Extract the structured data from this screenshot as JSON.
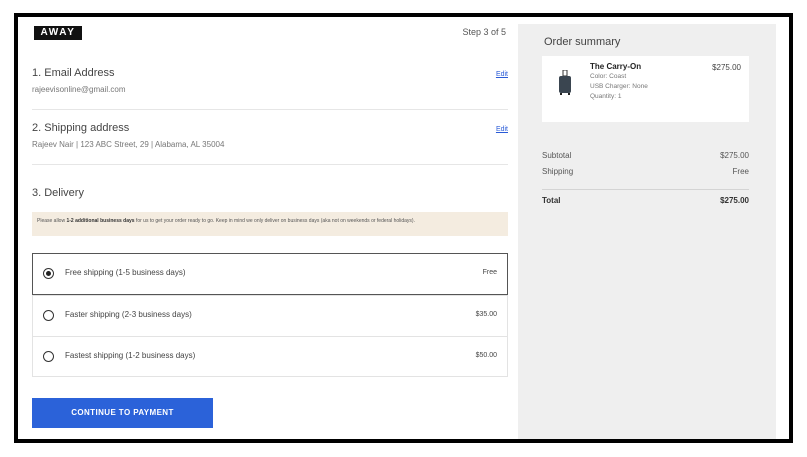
{
  "header": {
    "logo": "AWAY",
    "step": "Step 3 of 5"
  },
  "email": {
    "title": "1. Email Address",
    "value": "rajeevisonline@gmail.com",
    "edit": "Edit"
  },
  "shipping": {
    "title": "2. Shipping address",
    "value": "Rajeev Nair | 123 ABC Street, 29 | Alabama, AL 35004",
    "edit": "Edit"
  },
  "delivery": {
    "title": "3. Delivery",
    "notice_pre": "Please allow ",
    "notice_bold": "1-2 additional business days",
    "notice_post": " for us to get your order ready to go. Keep in mind we only deliver on business days (aka not on weekends or federal holidays).",
    "options": [
      {
        "label": "Free shipping (1-5 business days)",
        "price": "Free",
        "selected": true
      },
      {
        "label": "Faster shipping (2-3 business days)",
        "price": "$35.00",
        "selected": false
      },
      {
        "label": "Fastest shipping (1-2 business days)",
        "price": "$50.00",
        "selected": false
      }
    ]
  },
  "continue_label": "CONTINUE TO PAYMENT",
  "summary": {
    "title": "Order summary",
    "product": {
      "name": "The Carry-On",
      "color": "Color: Coast",
      "charger": "USB Charger: None",
      "quantity": "Quantity: 1",
      "price": "$275.00"
    },
    "subtotal_label": "Subtotal",
    "subtotal_value": "$275.00",
    "shipping_label": "Shipping",
    "shipping_value": "Free",
    "total_label": "Total",
    "total_value": "$275.00"
  },
  "colors": {
    "accent": "#2b62d9",
    "notice_bg": "#f4ece0",
    "summary_bg": "#efefef"
  }
}
